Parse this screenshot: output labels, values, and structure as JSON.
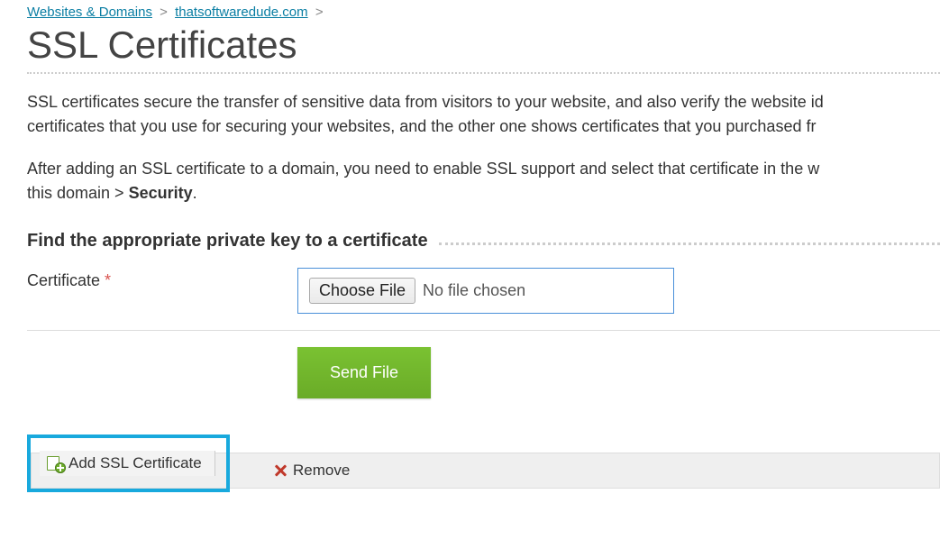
{
  "breadcrumb": {
    "items": [
      {
        "label": "Websites & Domains"
      },
      {
        "label": "thatsoftwaredude.com"
      }
    ],
    "sep": ">"
  },
  "title": "SSL Certificates",
  "intro": {
    "p1a": "SSL certificates secure the transfer of sensitive data from visitors to your website, and also verify the website id",
    "p1b": "certificates that you use for securing your websites, and the other one shows certificates that you purchased fr",
    "p2a": "After adding an SSL certificate to a domain, you need to enable SSL support and select that certificate in the w",
    "p2b_prefix": "this domain > ",
    "p2b_strong": "Security",
    "p2b_suffix": "."
  },
  "section": {
    "title": "Find the appropriate private key to a certificate"
  },
  "form": {
    "cert_label": "Certificate",
    "required_mark": "*",
    "choose_file": "Choose File",
    "file_status": "No file chosen",
    "send": "Send File"
  },
  "toolbar": {
    "add_label": "Add SSL Certificate",
    "remove_label": "Remove"
  }
}
